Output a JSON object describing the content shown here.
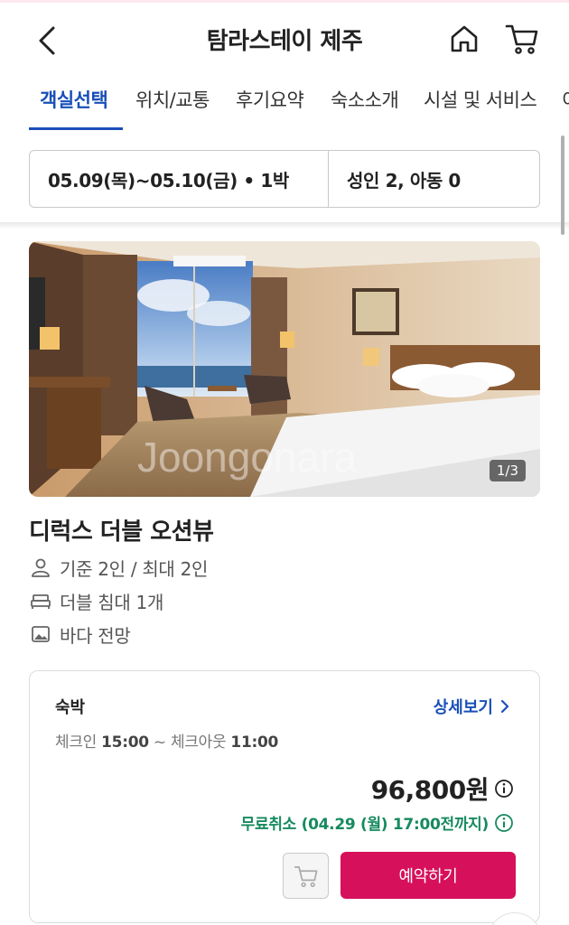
{
  "header": {
    "title": "탐라스테이 제주",
    "back_icon": "chevron-left-icon",
    "home_icon": "home-icon",
    "cart_icon": "cart-icon"
  },
  "tabs": [
    {
      "label": "객실선택",
      "active": true
    },
    {
      "label": "위치/교통",
      "active": false
    },
    {
      "label": "후기요약",
      "active": false
    },
    {
      "label": "숙소소개",
      "active": false
    },
    {
      "label": "시설 및 서비스",
      "active": false
    },
    {
      "label": "이",
      "active": false
    }
  ],
  "search": {
    "dates": "05.09(목)~05.10(금) • 1박",
    "guests": "성인 2, 아동 0"
  },
  "room": {
    "photo_counter": "1/3",
    "watermark": "Joongonara",
    "name": "디럭스 더블 오션뷰",
    "features": [
      {
        "icon": "person-icon",
        "text": "기준 2인 / 최대 2인"
      },
      {
        "icon": "bed-icon",
        "text": "더블 침대 1개"
      },
      {
        "icon": "image-icon",
        "text": "바다 전망"
      }
    ]
  },
  "offer": {
    "type": "숙박",
    "detail_label": "상세보기",
    "checkin_label": "체크인",
    "checkin_time": "15:00",
    "separator": "~",
    "checkout_label": "체크아웃",
    "checkout_time": "11:00",
    "price": "96,800원",
    "free_cancel": "무료취소 (04.29 (월) 17:00전까지)",
    "reserve_label": "예약하기"
  },
  "colors": {
    "accent_blue": "#1a4fb8",
    "reserve_red": "#d6105a",
    "cancel_green": "#178a5f"
  }
}
